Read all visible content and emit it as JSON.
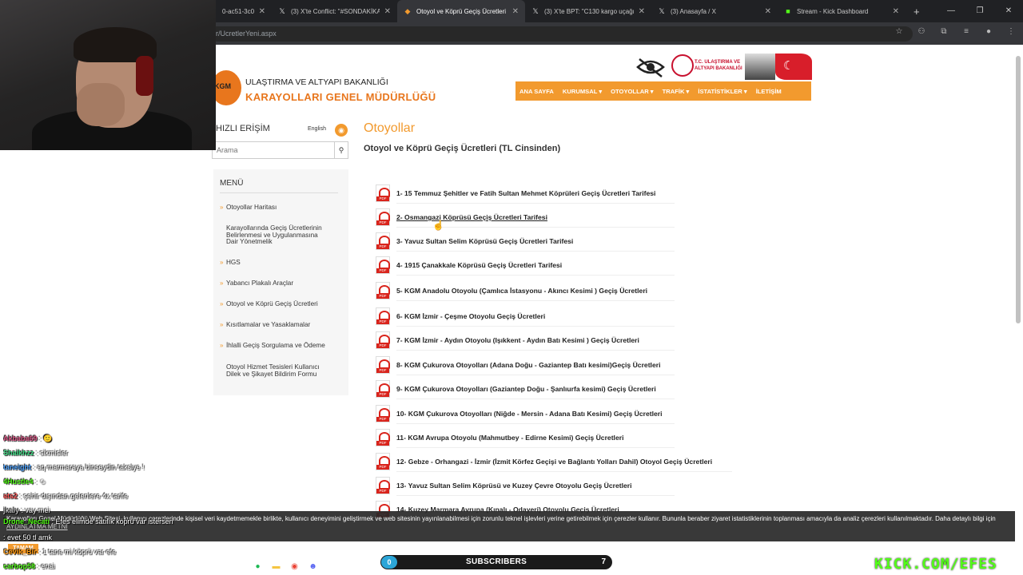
{
  "browser": {
    "tabs": [
      {
        "title": "0-ac51-3c0(",
        "icon": "page-icon"
      },
      {
        "title": "(3) X'te Conflict: \"#SONDAKİKA",
        "icon": "x-icon"
      },
      {
        "title": "Otoyol ve Köprü Geçiş Ücretleri",
        "icon": "kgm-icon"
      },
      {
        "title": "(3) X'te BPT: \"C130 kargo uçağı",
        "icon": "x-icon"
      },
      {
        "title": "(3) Anasayfa / X",
        "icon": "x-icon"
      },
      {
        "title": "Stream - Kick Dashboard",
        "icon": "kick-icon"
      }
    ],
    "url": "r/UcretlerYeni.aspx"
  },
  "site": {
    "logo_top": "ULAŞTIRMA VE ALTYAPI BAKANLIĞI",
    "logo_bottom": "KARAYOLLARI GENEL MÜDÜRLÜĞÜ",
    "ministry_text_1": "T.C. ULAŞTIRMA VE",
    "ministry_text_2": "ALTYAPI BAKANLIĞI",
    "nav": [
      "ANA SAYFA",
      "KURUMSAL ▾",
      "OTOYOLLAR ▾",
      "TRAFİK ▾",
      "İSTATİSTİKLER ▾",
      "İLETİŞİM"
    ]
  },
  "sidebar": {
    "quick_title": "HIZLI ERİŞİM",
    "lang": "English",
    "search_placeholder": "Arama",
    "menu_title": "MENÜ",
    "items": [
      {
        "lines": [
          "Otoyollar Haritası"
        ]
      },
      {
        "lines": [
          "Karayollarında Geçiş Ücretlerinin",
          "Belirlenmesi ve Uygulanmasına",
          "Dair Yönetmelik"
        ]
      },
      {
        "lines": [
          "HGS"
        ]
      },
      {
        "lines": [
          "Yabancı Plakalı Araçlar"
        ]
      },
      {
        "lines": [
          "Otoyol ve Köprü Geçiş Ücretleri"
        ]
      },
      {
        "lines": [
          "Kısıtlamalar ve Yasaklamalar"
        ]
      },
      {
        "lines": [
          "İhlalli Geçiş Sorgulama ve Ödeme"
        ]
      },
      {
        "lines": [
          "Otoyol Hizmet Tesisleri Kullanıcı",
          "Dilek ve Şikayet Bildirim Formu"
        ]
      }
    ]
  },
  "main": {
    "title": "Otoyollar",
    "subtitle": "Otoyol ve Köprü Geçiş Ücretleri (TL Cinsinden)",
    "documents": [
      "1- 15 Temmuz Şehitler ve Fatih Sultan Mehmet Köprüleri Geçiş Ücretleri Tarifesi",
      "2- Osmangazi Köprüsü Geçiş Ücretleri Tarifesi",
      "3- Yavuz Sultan Selim Köprüsü Geçiş Ücretleri Tarifesi",
      "4- 1915 Çanakkale Köprüsü Geçiş Ücretleri Tarifesi",
      "5- KGM Anadolu Otoyolu (Çamlıca İstasyonu - Akıncı Kesimi ) Geçiş Ücretleri",
      "6- KGM İzmir - Çeşme Otoyolu Geçiş Ücretleri",
      "7- KGM İzmir - Aydın Otoyolu (Işıkkent - Aydın Batı Kesimi ) Geçiş Ücretleri",
      "8- KGM Çukurova Otoyolları (Adana Doğu - Gaziantep Batı kesimi)Geçiş Ücretleri",
      "9- KGM Çukurova Otoyolları (Gaziantep Doğu - Şanlıurfa kesimi) Geçiş Ücretleri",
      "10- KGM Çukurova Otoyolları (Niğde - Mersin - Adana Batı Kesimi) Geçiş Ücretleri",
      "11- KGM Avrupa Otoyolu (Mahmutbey - Edirne Kesimi) Geçiş Ücretleri",
      "12- Gebze - Orhangazi - İzmir (İzmit Körfez Geçişi ve Bağlantı Yolları Dahil) Otoyol Geçiş Ücretleri",
      "13- Yavuz Sultan Selim Köprüsü ve Kuzey Çevre Otoyolu Geçiş Ücretleri",
      "14- Kuzey Marmara Avrupa (Kınalı - Odayeri) Otoyolu Geçiş Ücretleri"
    ]
  },
  "chat": [
    {
      "user": "Akbaba69",
      "msg": "",
      "color": "#e05a8a"
    },
    {
      "user": "Shaikhzz",
      "msg": "sikmisler",
      "color": "#3ddc84"
    },
    {
      "user": "taneight",
      "msg": "aq marmaraya binseydin takslye !",
      "color": "#4da3ff"
    },
    {
      "user": "4Hustle4",
      "msg": "",
      "color": "#53fc18"
    },
    {
      "user": "ats2",
      "msg": "şehir dışından gelenlere 4x tarife",
      "color": "#ff5a5a"
    },
    {
      "user": "jkaly",
      "msg": "vay mei",
      "color": "#bbbbbb"
    },
    {
      "user": "Drone_Necati",
      "msg": "Efes elimde satılık köprü var istersen",
      "color": "#53fc18"
    },
    {
      "user": "",
      "msg": "evet 50 tl amk",
      "color": "#ff5a5a"
    },
    {
      "user": "Cevik_Bir",
      "msg": "1 tane mi köprü var efe",
      "color": "#ff9f1a"
    },
    {
      "user": "carbop58",
      "msg": "enai",
      "color": "#53fc18"
    }
  ],
  "cookie": {
    "text": "Karayolları Genel Müdürlüğü Web Sitesi, kullanıcı çerezlerinde kişisel veri kaydetmemekle birlikte, kullanıcı deneyimini geliştirmek ve web sitesinin yayınlanabilmesi için zorunlu teknel işlevleri yerine getirebilmek için çerezler kullanır. Bununla beraber ziyaret istatistiklerinin toplanması amacıyla da analiz çerezleri kullanılmaktadır. Daha detaylı bilgi için",
    "link": "AYDINLATMA METNİ",
    "button": "TAMAM"
  },
  "subs": {
    "current": "0",
    "label": "SUBSCRIBERS",
    "goal": "7"
  },
  "kick_watermark": "KICK.COM/EFES"
}
